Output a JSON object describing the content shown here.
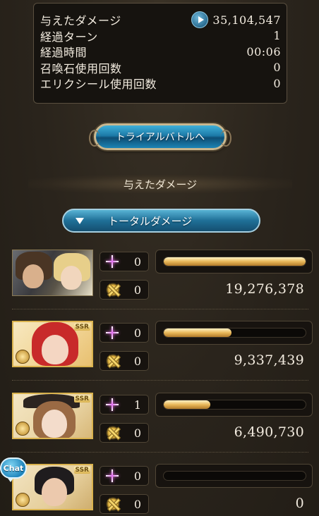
{
  "stats": [
    {
      "label": "与えたダメージ",
      "value": "35,104,547",
      "icon": "play-icon"
    },
    {
      "label": "経過ターン",
      "value": "1"
    },
    {
      "label": "経過時間",
      "value": "00:06"
    },
    {
      "label": "召喚石使用回数",
      "value": "0"
    },
    {
      "label": "エリクシール使用回数",
      "value": "0"
    }
  ],
  "trial_button": "トライアルバトルへ",
  "section_title": "与えたダメージ",
  "damage_select": {
    "selected": "トータルダメージ",
    "icon": "triangle-down-icon"
  },
  "characters": [
    {
      "star_count": "0",
      "sword_count": "0",
      "damage": "19,276,378",
      "bar_fraction": 1.0,
      "rarity": "",
      "icon_star": "star-sparkle-icon",
      "icon_sword": "crossed-swords-icon"
    },
    {
      "star_count": "0",
      "sword_count": "0",
      "damage": "9,337,439",
      "bar_fraction": 0.48,
      "rarity": "SSR",
      "icon_star": "star-sparkle-icon",
      "icon_sword": "crossed-swords-icon"
    },
    {
      "star_count": "1",
      "sword_count": "0",
      "damage": "6,490,730",
      "bar_fraction": 0.33,
      "rarity": "SSR",
      "icon_star": "star-sparkle-icon",
      "icon_sword": "crossed-swords-icon"
    },
    {
      "star_count": "0",
      "sword_count": "0",
      "damage": "0",
      "bar_fraction": 0.0,
      "rarity": "SSR",
      "icon_star": "star-sparkle-icon",
      "icon_sword": "crossed-swords-icon"
    }
  ],
  "chat_button": "Chat",
  "colors": {
    "accent_blue": "#1f6f97",
    "bar_gold": "#e9b85a",
    "panel_bg": "#16130f"
  }
}
